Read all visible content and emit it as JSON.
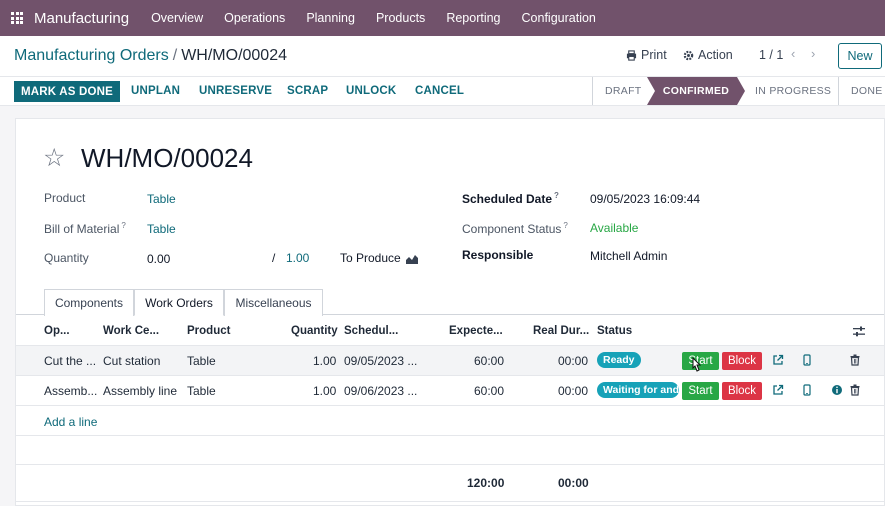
{
  "app": {
    "name": "Manufacturing",
    "menu": [
      "Overview",
      "Operations",
      "Planning",
      "Products",
      "Reporting",
      "Configuration"
    ]
  },
  "breadcrumb": {
    "parent": "Manufacturing Orders",
    "separator": "/",
    "current": "WH/MO/00024"
  },
  "actions": {
    "print": "Print",
    "action": "Action",
    "pager": "1 / 1",
    "new": "New"
  },
  "header_buttons": {
    "mark_done": "MARK AS DONE",
    "unplan": "UNPLAN",
    "unreserve": "UNRESERVE",
    "scrap": "SCRAP",
    "unlock": "UNLOCK",
    "cancel": "CANCEL"
  },
  "stages": {
    "draft": "DRAFT",
    "confirmed": "CONFIRMED",
    "in_progress": "IN PROGRESS",
    "done": "DONE",
    "active": "CONFIRMED"
  },
  "record": {
    "title": "WH/MO/00024",
    "product_label": "Product",
    "product": "Table",
    "bom_label": "Bill of Material",
    "bom": "Table",
    "quantity_label": "Quantity",
    "quantity_done": "0.00",
    "quantity_sep": "/",
    "quantity_total": "1.00",
    "to_produce": "To Produce",
    "scheduled_label": "Scheduled Date",
    "scheduled": "09/05/2023 16:09:44",
    "component_status_label": "Component Status",
    "component_status": "Available",
    "responsible_label": "Responsible",
    "responsible": "Mitchell Admin",
    "help_mark": "?"
  },
  "tabs": [
    "Components",
    "Work Orders",
    "Miscellaneous"
  ],
  "active_tab": "Work Orders",
  "work_orders": {
    "columns": [
      "Op...",
      "Work Ce...",
      "Product",
      "Quantity",
      "Schedul...",
      "Expecte...",
      "Real Dur...",
      "Status"
    ],
    "rows": [
      {
        "operation": "Cut the ...",
        "work_center": "Cut station",
        "product": "Table",
        "quantity": "1.00",
        "scheduled": "09/05/2023 ...",
        "expected": "60:00",
        "real": "00:00",
        "status": "Ready",
        "start": "Start",
        "block": "Block"
      },
      {
        "operation": "Assemb...",
        "work_center": "Assembly line",
        "product": "Table",
        "quantity": "1.00",
        "scheduled": "09/06/2023 ...",
        "expected": "60:00",
        "real": "00:00",
        "status": "Waiting for and",
        "start": "Start",
        "block": "Block"
      }
    ],
    "add_line": "Add a line",
    "total_expected": "120:00",
    "total_real": "00:00"
  },
  "colors": {
    "brand": "#71526b",
    "primary": "#0f6a7a",
    "success": "#28a745",
    "danger": "#dc3545",
    "info": "#17a2b8"
  }
}
